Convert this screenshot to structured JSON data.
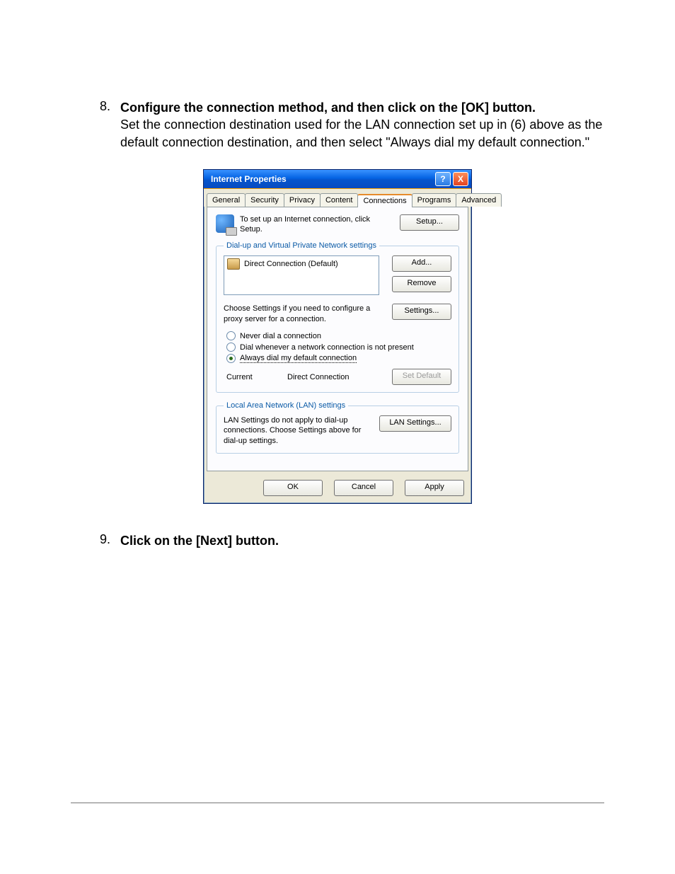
{
  "steps": {
    "s8": {
      "num": "8.",
      "title": "Configure the connection method, and then click on the [OK] button.",
      "body": "Set the connection destination used for the LAN connection set up in (6) above as the default connection destination, and then select \"Always dial my default connection.\""
    },
    "s9": {
      "num": "9.",
      "title": "Click on the [Next] button."
    }
  },
  "dialog": {
    "title": "Internet Properties",
    "help": "?",
    "close": "X",
    "tabs": {
      "general": "General",
      "security": "Security",
      "privacy": "Privacy",
      "content": "Content",
      "connections": "Connections",
      "programs": "Programs",
      "advanced": "Advanced"
    },
    "setup": {
      "text": "To set up an Internet connection, click Setup.",
      "button": "Setup..."
    },
    "dialup": {
      "legend": "Dial-up and Virtual Private Network settings",
      "item": "Direct Connection (Default)",
      "add": "Add...",
      "remove": "Remove",
      "settings_text": "Choose Settings if you need to configure a proxy server for a connection.",
      "settings": "Settings...",
      "opt_never": "Never dial a connection",
      "opt_when": "Dial whenever a network connection is not present",
      "opt_always": "Always dial my default connection",
      "current_lbl": "Current",
      "current_val": "Direct Connection",
      "set_default": "Set Default"
    },
    "lan": {
      "legend": "Local Area Network (LAN) settings",
      "text": "LAN Settings do not apply to dial-up connections. Choose Settings above for dial-up settings.",
      "button": "LAN Settings..."
    },
    "actions": {
      "ok": "OK",
      "cancel": "Cancel",
      "apply": "Apply"
    }
  }
}
